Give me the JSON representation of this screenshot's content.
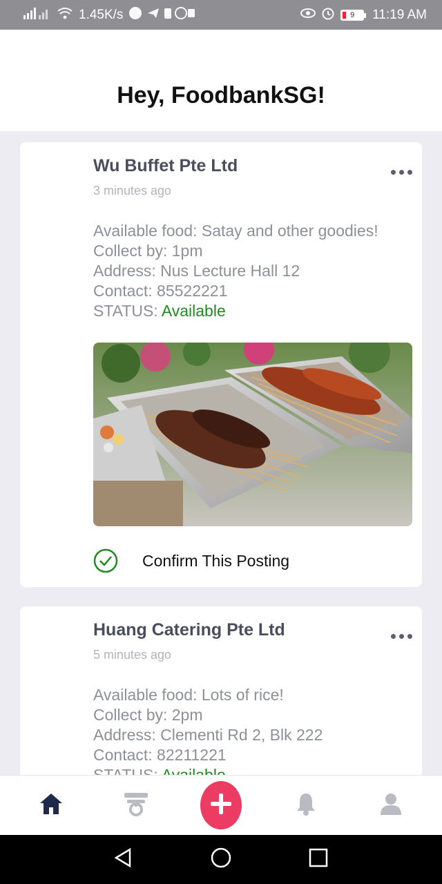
{
  "status_bar": {
    "network_speed": "1.45K/s",
    "battery_level": "9",
    "time": "11:19 AM"
  },
  "header": {
    "greeting": "Hey, FoodbankSG!"
  },
  "posts": [
    {
      "company": "Wu Buffet Pte Ltd",
      "time_ago": "3 minutes ago",
      "food_label": "Available food: ",
      "food": "Satay and other goodies!",
      "collect_label": "Collect by: ",
      "collect": "1pm",
      "address_label": "Address: ",
      "address": "Nus Lecture Hall 12",
      "contact_label": "Contact: ",
      "contact": "85522221",
      "status_label": "STATUS: ",
      "status": "Available",
      "image_icon": "satay-food-photo",
      "confirm_label": "Confirm This Posting"
    },
    {
      "company": "Huang Catering Pte Ltd",
      "time_ago": "5 minutes ago",
      "food_label": "Available food: ",
      "food": "Lots of rice!",
      "collect_label": "Collect by: ",
      "collect": "2pm",
      "address_label": "Address: ",
      "address": "Clementi Rd 2, Blk 222",
      "contact_label": "Contact: ",
      "contact": "82211221",
      "status_label": "STATUS: ",
      "status": "Available"
    }
  ],
  "bottom_nav": {
    "items": [
      "home-icon",
      "donation-icon",
      "add-icon",
      "bell-icon",
      "profile-icon"
    ],
    "active": "home-icon"
  },
  "colors": {
    "accent": "#ec3c64",
    "status_available": "#1f8a1f",
    "nav_active": "#1e2a4a"
  }
}
